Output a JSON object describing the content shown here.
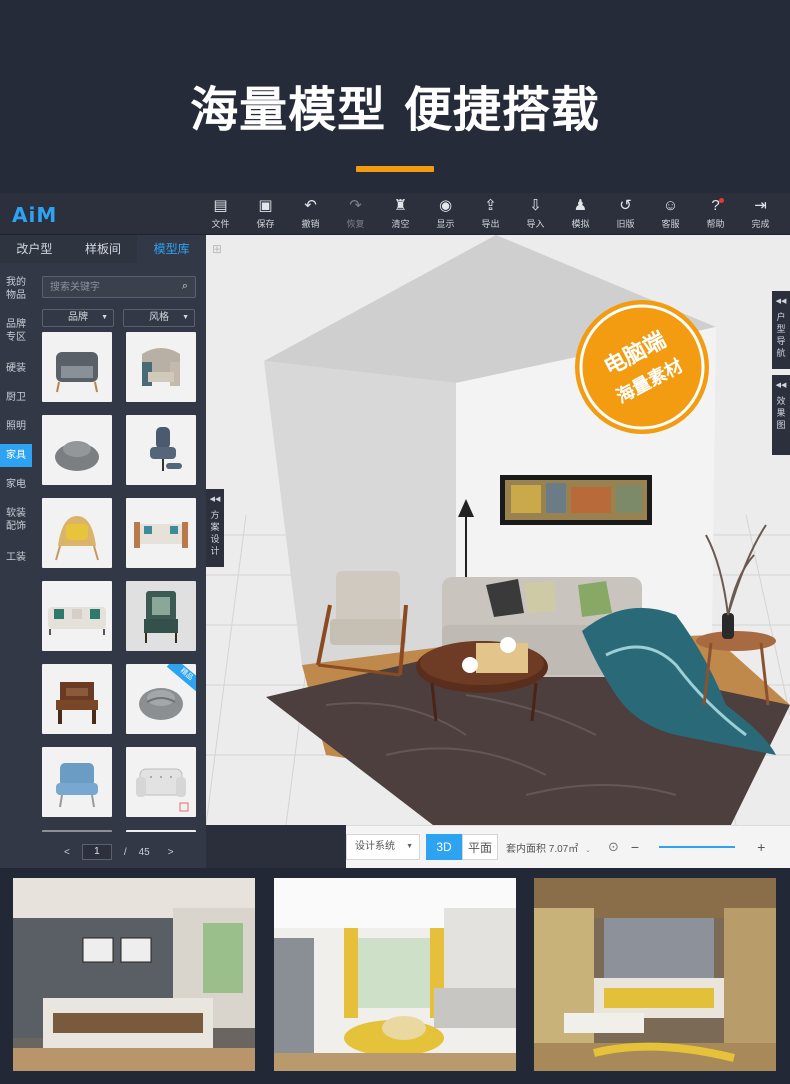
{
  "banner": {
    "title": "海量模型 便捷搭载"
  },
  "app": {
    "logo": "AiM",
    "toolbar": [
      {
        "name": "file",
        "label": "文件",
        "icon": "▤",
        "disabled": false
      },
      {
        "name": "save",
        "label": "保存",
        "icon": "▣",
        "disabled": false
      },
      {
        "name": "undo",
        "label": "撤销",
        "icon": "↶",
        "disabled": false
      },
      {
        "name": "redo",
        "label": "恢复",
        "icon": "↷",
        "disabled": true
      },
      {
        "name": "clear",
        "label": "清空",
        "icon": "♜",
        "disabled": false
      },
      {
        "name": "display",
        "label": "显示",
        "icon": "◉",
        "disabled": false
      },
      {
        "name": "export",
        "label": "导出",
        "icon": "⇪",
        "disabled": false
      },
      {
        "name": "import",
        "label": "导入",
        "icon": "⇩",
        "disabled": false
      },
      {
        "name": "simulate",
        "label": "模拟",
        "icon": "♟",
        "disabled": false
      },
      {
        "name": "old-version",
        "label": "旧版",
        "icon": "↺",
        "disabled": false
      },
      {
        "name": "service",
        "label": "客服",
        "icon": "☺",
        "disabled": false
      },
      {
        "name": "help",
        "label": "帮助",
        "icon": "?",
        "disabled": false
      },
      {
        "name": "done",
        "label": "完成",
        "icon": "⇥",
        "disabled": false
      }
    ],
    "tabs": [
      "改户型",
      "样板间",
      "模型库"
    ],
    "active_tab": 2,
    "categories": [
      {
        "label": "我的\n物品"
      },
      {
        "label": "品牌\n专区"
      },
      {
        "label": "硬装"
      },
      {
        "label": "厨卫"
      },
      {
        "label": "照明"
      },
      {
        "label": "家具",
        "active": true
      },
      {
        "label": "家电"
      },
      {
        "label": "软装\n配饰"
      },
      {
        "label": "工装"
      }
    ],
    "search": {
      "placeholder": "搜索关键字"
    },
    "filters": {
      "brand": "品牌",
      "style": "风格"
    },
    "badge_text": "精品",
    "pager": {
      "prev": "<",
      "current": "1",
      "sep": "/",
      "total": "45",
      "next": ">"
    },
    "right_tabs": {
      "floor_nav": "户\n型\n导\n航",
      "effect": "效\n果\n图"
    },
    "plan_tab": "方\n案\n设\n计",
    "promo": {
      "line1": "电脑端",
      "line2": "海量素材"
    },
    "bottom": {
      "design_system": "设计系统",
      "mode_3d": "3D",
      "mode_plane": "平面",
      "area": "套内面积 7.07㎡",
      "minus": "−",
      "plus": "+"
    }
  }
}
